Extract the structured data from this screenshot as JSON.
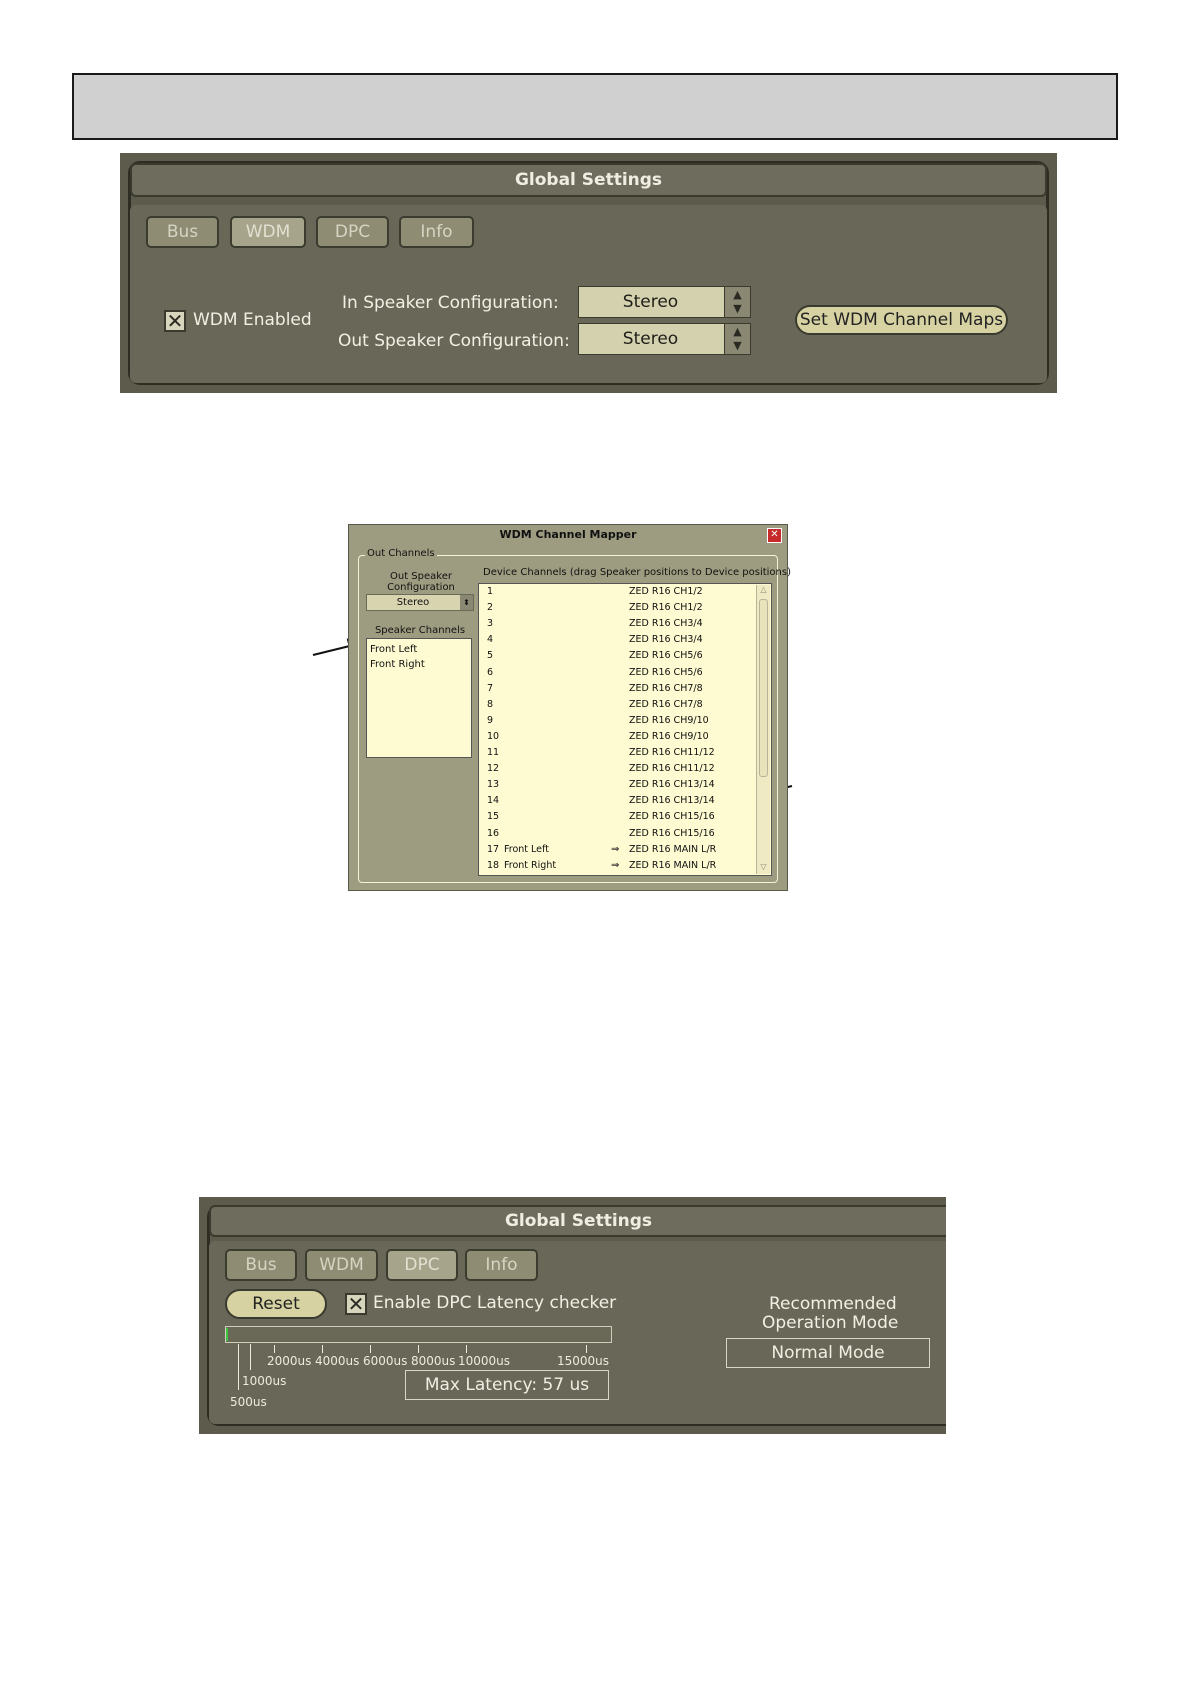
{
  "panel1": {
    "title": "Global Settings",
    "tabs": [
      "Bus",
      "WDM",
      "DPC",
      "Info"
    ],
    "active_tab": "WDM",
    "wdm_enabled_label": "WDM Enabled",
    "wdm_enabled_mark": "✕",
    "in_speaker_label": "In Speaker Configuration:",
    "in_speaker_value": "Stereo",
    "out_speaker_label": "Out Speaker Configuration:",
    "out_speaker_value": "Stereo",
    "set_maps_button": "Set WDM Channel Maps"
  },
  "mapper": {
    "title": "WDM Channel Mapper",
    "close_glyph": "✕",
    "group_label": "Out Channels",
    "out_speaker_config_label": "Out Speaker Configuration",
    "out_speaker_config_value": "Stereo",
    "speaker_channels_label": "Speaker Channels",
    "speaker_channels": [
      "Front Left",
      "Front Right"
    ],
    "device_channels_label": "Device Channels (drag Speaker positions to Device positions)",
    "device_rows": [
      {
        "n": "1",
        "speaker": "",
        "channel": "ZED R16 CH1/2"
      },
      {
        "n": "2",
        "speaker": "",
        "channel": "ZED R16 CH1/2"
      },
      {
        "n": "3",
        "speaker": "",
        "channel": "ZED R16 CH3/4"
      },
      {
        "n": "4",
        "speaker": "",
        "channel": "ZED R16 CH3/4"
      },
      {
        "n": "5",
        "speaker": "",
        "channel": "ZED R16 CH5/6"
      },
      {
        "n": "6",
        "speaker": "",
        "channel": "ZED R16 CH5/6"
      },
      {
        "n": "7",
        "speaker": "",
        "channel": "ZED R16 CH7/8"
      },
      {
        "n": "8",
        "speaker": "",
        "channel": "ZED R16 CH7/8"
      },
      {
        "n": "9",
        "speaker": "",
        "channel": "ZED R16 CH9/10"
      },
      {
        "n": "10",
        "speaker": "",
        "channel": "ZED R16 CH9/10"
      },
      {
        "n": "11",
        "speaker": "",
        "channel": "ZED R16 CH11/12"
      },
      {
        "n": "12",
        "speaker": "",
        "channel": "ZED R16 CH11/12"
      },
      {
        "n": "13",
        "speaker": "",
        "channel": "ZED R16 CH13/14"
      },
      {
        "n": "14",
        "speaker": "",
        "channel": "ZED R16 CH13/14"
      },
      {
        "n": "15",
        "speaker": "",
        "channel": "ZED R16 CH15/16"
      },
      {
        "n": "16",
        "speaker": "",
        "channel": "ZED R16 CH15/16"
      },
      {
        "n": "17",
        "speaker": "Front Left",
        "channel": "ZED R16 MAIN L/R"
      },
      {
        "n": "18",
        "speaker": "Front Right",
        "channel": "ZED R16 MAIN L/R"
      }
    ]
  },
  "panel2": {
    "title": "Global Settings",
    "tabs": [
      "Bus",
      "WDM",
      "DPC",
      "Info"
    ],
    "active_tab": "DPC",
    "reset_button": "Reset",
    "enable_dpc_label": "Enable DPC Latency checker",
    "enable_dpc_mark": "✕",
    "scale_labels": [
      "2000us",
      "4000us",
      "6000us",
      "8000us",
      "10000us",
      "15000us",
      "1000us",
      "500us"
    ],
    "max_latency": "Max Latency: 57 us",
    "recommended_label_1": "Recommended",
    "recommended_label_2": "Operation Mode",
    "mode_value": "Normal Mode"
  },
  "colors": {
    "panel_bg": "#5d5b4c",
    "tab_bg": "#8e8d74",
    "pill_bg": "#d6d2a2",
    "list_bg": "#fefad2",
    "close_red": "#c72a2a"
  }
}
